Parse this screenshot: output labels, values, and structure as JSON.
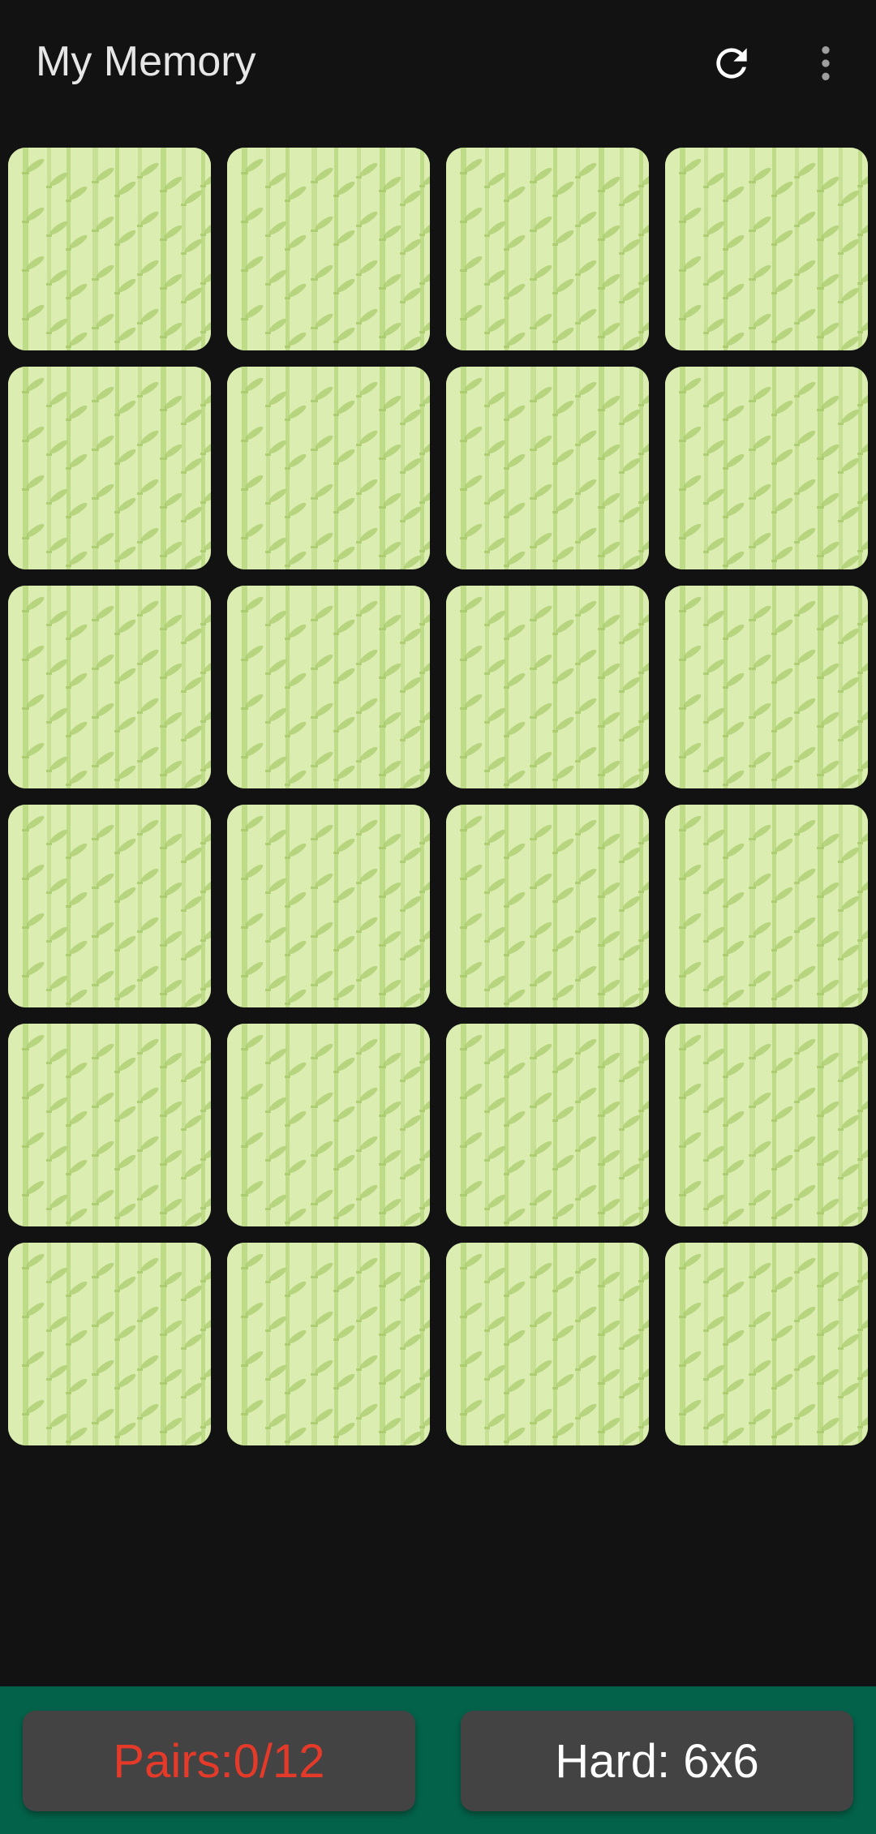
{
  "app": {
    "title": "My Memory"
  },
  "toolbar": {
    "refresh_icon": "refresh-icon",
    "more_icon": "more-vert-icon"
  },
  "board": {
    "rows": 6,
    "columns": 4,
    "card_back": "bamboo-pattern",
    "card_state": "face-down",
    "colors": {
      "card_bg": "#dcedb1",
      "stalk": "#b4d47a",
      "leaf": "#a6c96a"
    }
  },
  "status": {
    "pairs_label": "Pairs:0/12",
    "level_label": "Hard: 6x6",
    "pairs_color": "#e53a2a",
    "bar_color": "#03634a"
  }
}
